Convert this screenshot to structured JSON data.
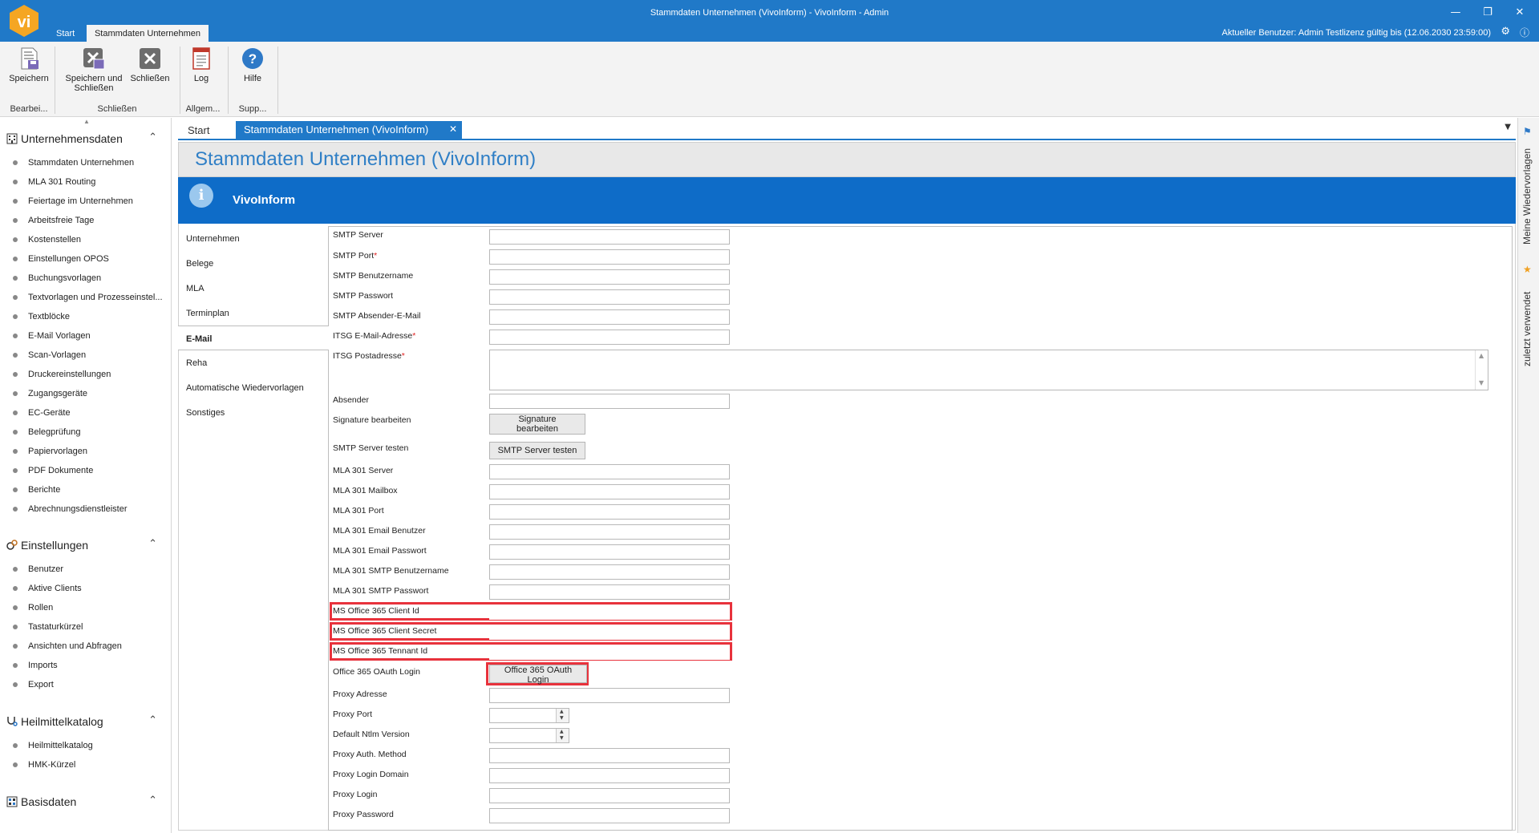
{
  "window": {
    "title": "Stammdaten Unternehmen (VivoInform) - VivoInform - Admin",
    "logo_text": "vi",
    "minimize": "—",
    "maximize": "❐",
    "close": "✕"
  },
  "ribbon_tabs": {
    "start": "Start",
    "active": "Stammdaten Unternehmen"
  },
  "user_status": "Aktueller Benutzer: Admin Testlizenz gültig bis (12.06.2030 23:59:00)",
  "ribbon": {
    "buttons": {
      "save": "Speichern",
      "save_close_line1": "Speichern und",
      "save_close_line2": "Schließen",
      "close": "Schließen",
      "log": "Log",
      "help": "Hilfe"
    },
    "groups": {
      "edit": "Bearbei...",
      "close": "Schließen",
      "general": "Allgem...",
      "support": "Supp..."
    }
  },
  "sidebar": {
    "sections": [
      {
        "title": "Unternehmensdaten",
        "items": [
          "Stammdaten Unternehmen",
          "MLA 301 Routing",
          "Feiertage im Unternehmen",
          "Arbeitsfreie Tage",
          "Kostenstellen",
          "Einstellungen OPOS",
          "Buchungsvorlagen",
          "Textvorlagen und Prozesseinstel...",
          "Textblöcke",
          "E-Mail Vorlagen",
          "Scan-Vorlagen",
          "Druckereinstellungen",
          "Zugangsgeräte",
          "EC-Geräte",
          "Belegprüfung",
          "Papiervorlagen",
          "PDF Dokumente",
          "Berichte",
          "Abrechnungsdienstleister"
        ]
      },
      {
        "title": "Einstellungen",
        "items": [
          "Benutzer",
          "Aktive Clients",
          "Rollen",
          "Tastaturkürzel",
          "Ansichten und Abfragen",
          "Imports",
          "Export"
        ]
      },
      {
        "title": "Heilmittelkatalog",
        "items": [
          "Heilmittelkatalog",
          "HMK-Kürzel"
        ]
      },
      {
        "title": "Basisdaten",
        "items": []
      }
    ]
  },
  "doc_tabs": {
    "start": "Start",
    "active": "Stammdaten Unternehmen (VivoInform)"
  },
  "page": {
    "title": "Stammdaten Unternehmen (VivoInform)",
    "banner_title": "VivoInform"
  },
  "nav": {
    "items": [
      "Unternehmen",
      "Belege",
      "MLA",
      "Terminplan",
      "E-Mail",
      "Reha",
      "Automatische Wiedervorlagen",
      "Sonstiges"
    ],
    "active": "E-Mail"
  },
  "form": {
    "labels": {
      "smtp_server": "SMTP Server",
      "smtp_port": "SMTP Port",
      "smtp_user": "SMTP Benutzername",
      "smtp_password": "SMTP Passwort",
      "smtp_sender": "SMTP Absender-E-Mail",
      "itsg_email": "ITSG E-Mail-Adresse",
      "itsg_postal": "ITSG Postadresse",
      "absender": "Absender",
      "signature": "Signature bearbeiten",
      "smtp_test": "SMTP Server testen",
      "mla_server": "MLA 301 Server",
      "mla_mailbox": "MLA 301 Mailbox",
      "mla_port": "MLA 301 Port",
      "mla_email_user": "MLA 301 Email Benutzer",
      "mla_email_password": "MLA 301 Email Passwort",
      "mla_smtp_user": "MLA 301 SMTP Benutzername",
      "mla_smtp_password": "MLA 301 SMTP Passwort",
      "ms_client_id": "MS Office 365 Client Id",
      "ms_client_secret": "MS Office 365 Client Secret",
      "ms_tenant_id": "MS Office 365 Tennant Id",
      "oauth_login": "Office 365 OAuth Login",
      "proxy_address": "Proxy Adresse",
      "proxy_port": "Proxy Port",
      "ntlm_version": "Default Ntlm Version",
      "proxy_auth": "Proxy Auth. Method",
      "proxy_domain": "Proxy Login Domain",
      "proxy_login": "Proxy Login",
      "proxy_password": "Proxy Password"
    },
    "required_mark": "*",
    "buttons": {
      "signature": "Signature bearbeiten",
      "smtp_test": "SMTP Server testen",
      "oauth_login": "Office 365 OAuth Login"
    }
  },
  "right_panel": {
    "tab1": "Meine Wiedervorlagen",
    "tab2": "zuletzt verwendet"
  },
  "colors": {
    "accent": "#2079c8",
    "banner": "#0e6cc8",
    "highlight": "#e8323c",
    "logo": "#f5a623"
  },
  "icons": [
    "save-icon",
    "save-close-icon",
    "close-icon",
    "log-icon",
    "help-icon",
    "building-icon",
    "gears-icon",
    "stethoscope-icon",
    "database-icon",
    "info-icon",
    "gear-icon",
    "chevron-up-icon",
    "star-icon",
    "flag-icon"
  ]
}
